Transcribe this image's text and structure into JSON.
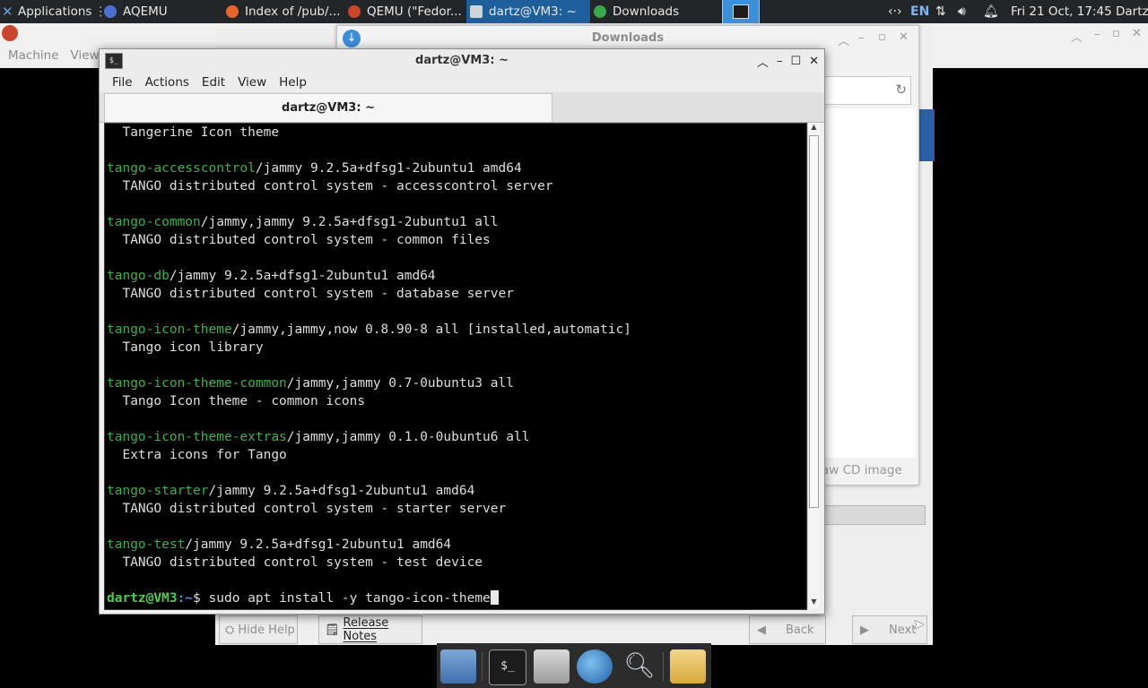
{
  "top_panel": {
    "applications_label": "Applications",
    "tasks": [
      {
        "label": "AQEMU",
        "icon": "aqemu-icon",
        "color": "#4a6fd0"
      },
      {
        "label": "Index of /pub/...",
        "icon": "firefox-icon",
        "color": "#e8642b"
      },
      {
        "label": "QEMU (\"Fedor...",
        "icon": "qemu-icon",
        "color": "#c9462d"
      },
      {
        "label": "dartz@VM3: ~",
        "icon": "terminal-icon",
        "color": "#cfd4d8"
      },
      {
        "label": "Downloads",
        "icon": "downloads-icon",
        "color": "#38a84a"
      }
    ],
    "keyboard_layout": "EN",
    "clock": "Fri 21 Oct, 17:45",
    "user": "Dartz"
  },
  "aqemu": {
    "menu": [
      "Machine",
      "View"
    ]
  },
  "downloads_window": {
    "title": "Downloads",
    "raw_cd_text": "aw CD image"
  },
  "wizard": {
    "hide_help": "Hide Help",
    "release_notes": "Release Notes",
    "back": "Back",
    "next": "Next"
  },
  "terminal": {
    "title": "dartz@VM3: ~",
    "tab_label": "dartz@VM3: ~",
    "menu": [
      "File",
      "Actions",
      "Edit",
      "View",
      "Help"
    ],
    "lines": [
      {
        "pkg": "",
        "rest": "  Tangerine Icon theme"
      },
      {
        "pkg": "",
        "rest": ""
      },
      {
        "pkg": "tango-accesscontrol",
        "rest": "/jammy 9.2.5a+dfsg1-2ubuntu1 amd64"
      },
      {
        "pkg": "",
        "rest": "  TANGO distributed control system - accesscontrol server"
      },
      {
        "pkg": "",
        "rest": ""
      },
      {
        "pkg": "tango-common",
        "rest": "/jammy,jammy 9.2.5a+dfsg1-2ubuntu1 all"
      },
      {
        "pkg": "",
        "rest": "  TANGO distributed control system - common files"
      },
      {
        "pkg": "",
        "rest": ""
      },
      {
        "pkg": "tango-db",
        "rest": "/jammy 9.2.5a+dfsg1-2ubuntu1 amd64"
      },
      {
        "pkg": "",
        "rest": "  TANGO distributed control system - database server"
      },
      {
        "pkg": "",
        "rest": ""
      },
      {
        "pkg": "tango-icon-theme",
        "rest": "/jammy,jammy,now 0.8.90-8 all [installed,automatic]"
      },
      {
        "pkg": "",
        "rest": "  Tango icon library"
      },
      {
        "pkg": "",
        "rest": ""
      },
      {
        "pkg": "tango-icon-theme-common",
        "rest": "/jammy,jammy 0.7-0ubuntu3 all"
      },
      {
        "pkg": "",
        "rest": "  Tango Icon theme - common icons"
      },
      {
        "pkg": "",
        "rest": ""
      },
      {
        "pkg": "tango-icon-theme-extras",
        "rest": "/jammy,jammy 0.1.0-0ubuntu6 all"
      },
      {
        "pkg": "",
        "rest": "  Extra icons for Tango"
      },
      {
        "pkg": "",
        "rest": ""
      },
      {
        "pkg": "tango-starter",
        "rest": "/jammy 9.2.5a+dfsg1-2ubuntu1 amd64"
      },
      {
        "pkg": "",
        "rest": "  TANGO distributed control system - starter server"
      },
      {
        "pkg": "",
        "rest": ""
      },
      {
        "pkg": "tango-test",
        "rest": "/jammy 9.2.5a+dfsg1-2ubuntu1 amd64"
      },
      {
        "pkg": "",
        "rest": "  TANGO distributed control system - test device"
      },
      {
        "pkg": "",
        "rest": ""
      }
    ],
    "prompt_user": "dartz@VM3",
    "prompt_path": ":~",
    "prompt_symbol": "$",
    "command": " sudo apt install -y tango-icon-theme"
  },
  "dock": {
    "items": [
      "file-manager-icon",
      "terminal-icon",
      "home-folder-icon",
      "web-browser-icon",
      "search-icon",
      "folder-icon"
    ]
  }
}
